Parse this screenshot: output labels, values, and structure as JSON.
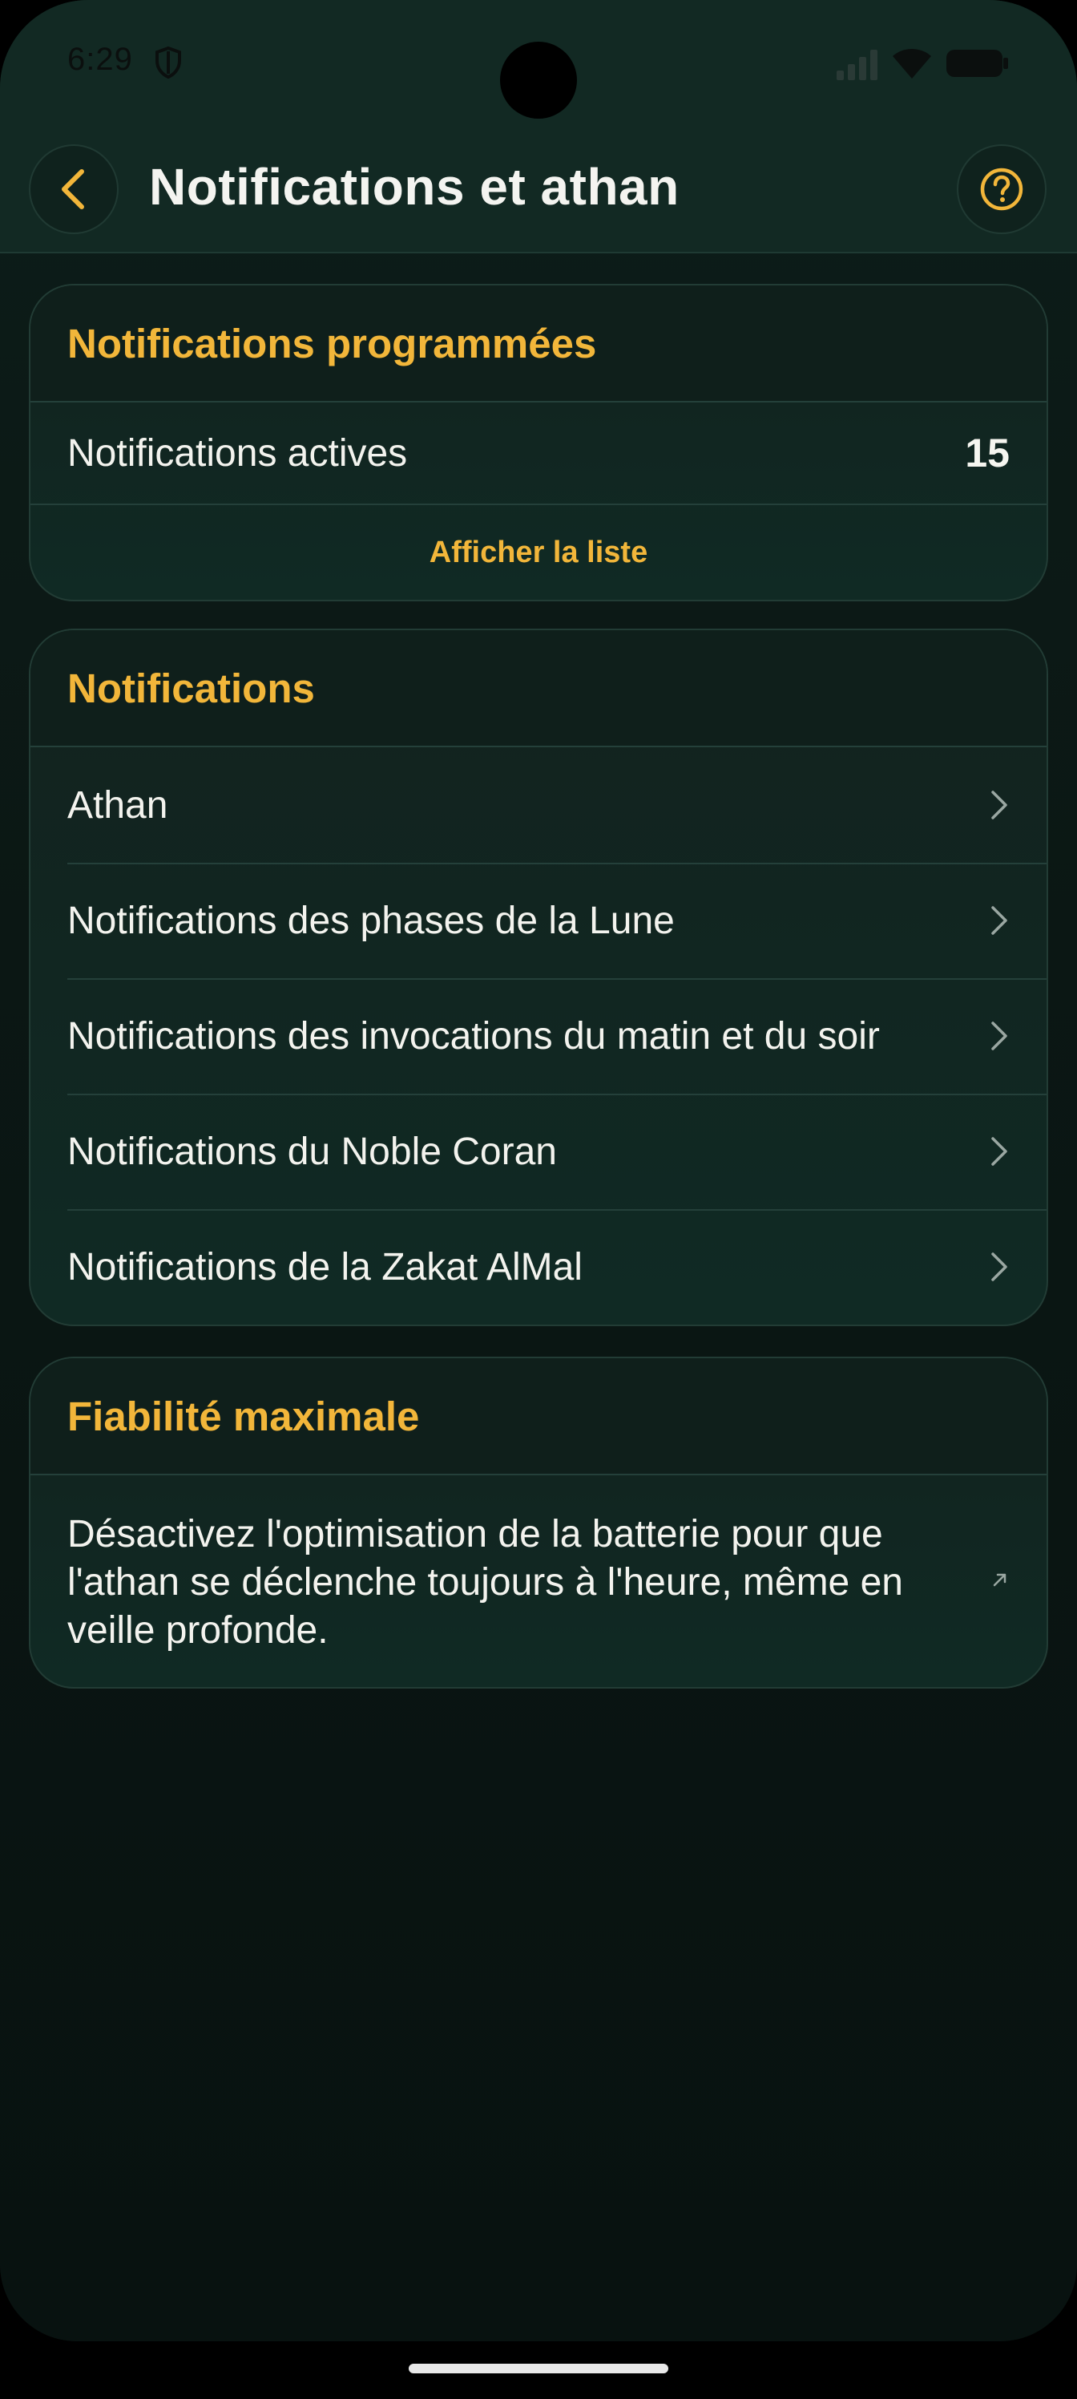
{
  "status_bar": {
    "time": "6:29"
  },
  "header": {
    "title": "Notifications et athan"
  },
  "scheduled": {
    "title": "Notifications programmées",
    "active_label": "Notifications actives",
    "active_count": "15",
    "show_list": "Afficher la liste"
  },
  "notifications": {
    "title": "Notifications",
    "items": [
      {
        "label": "Athan"
      },
      {
        "label": "Notifications des phases de la Lune"
      },
      {
        "label": "Notifications des invocations du matin et du soir"
      },
      {
        "label": "Notifications du Noble Coran"
      },
      {
        "label": "Notifications de la Zakat AlMal"
      }
    ]
  },
  "reliability": {
    "title": "Fiabilité maximale",
    "description": "Désactivez l'optimisation de la batterie pour que l'athan se déclenche toujours à l'heure, même en veille profonde."
  },
  "colors": {
    "accent": "#f2b63a",
    "background": "#0b1714",
    "card": "#12221e",
    "text": "#f3f3ee"
  },
  "icons": {
    "back": "chevron-left-icon",
    "help": "question-circle-icon",
    "row_arrow": "chevron-right-icon",
    "external": "arrow-up-right-icon"
  }
}
